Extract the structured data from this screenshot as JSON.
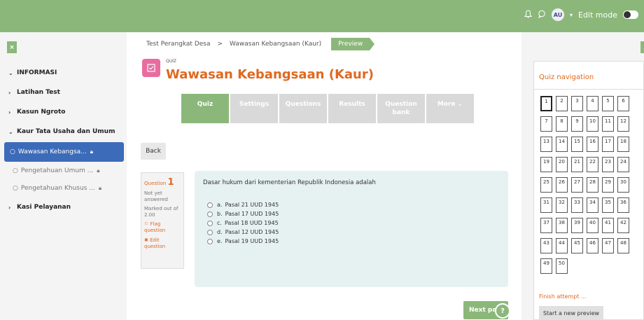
{
  "topbar": {
    "avatar_initials": "AU",
    "edit_mode_label": "Edit mode"
  },
  "drawer": {
    "close_glyph": "×",
    "items": [
      {
        "label": "INFORMASI",
        "kind": "section-open"
      },
      {
        "label": "Latihan Test",
        "kind": "section-closed"
      },
      {
        "label": "Kasun Ngroto",
        "kind": "section-closed"
      },
      {
        "label": "Kaur Tata Usaha dan Umum",
        "kind": "section-open"
      },
      {
        "label": "Wawasan Kebangsa...",
        "kind": "activity-active"
      },
      {
        "label": "Pengetahuan Umum ...",
        "kind": "activity"
      },
      {
        "label": "Pengetahuan Khusus ...",
        "kind": "activity"
      },
      {
        "label": "Kasi Pelayanan",
        "kind": "section-closed"
      }
    ]
  },
  "breadcrumb": {
    "items": [
      "Test Perangkat Desa",
      "Wawasan Kebangsaan (Kaur)"
    ],
    "separator": ">",
    "preview_label": "Preview"
  },
  "header": {
    "module_tag": "QUIZ",
    "title": "Wawasan Kebangsaan (Kaur)"
  },
  "tabs": [
    {
      "label": "Quiz",
      "active": true
    },
    {
      "label": "Settings",
      "active": false
    },
    {
      "label": "Questions",
      "active": false
    },
    {
      "label": "Results",
      "active": false
    },
    {
      "label": "Question bank",
      "active": false
    },
    {
      "label": "More ⌄",
      "active": false
    }
  ],
  "back_label": "Back",
  "question_info": {
    "label": "Question",
    "number": "1",
    "state": "Not yet answered",
    "marks": "Marked out of 2.00",
    "flag_label": "Flag question",
    "edit_label": "Edit question"
  },
  "question": {
    "text": "Dasar hukum dari kementerian Republik Indonesia adalah",
    "answers": [
      {
        "letter": "a.",
        "text": "Pasal 21 UUD 1945"
      },
      {
        "letter": "b.",
        "text": "Pasal 17 UUD 1945"
      },
      {
        "letter": "c.",
        "text": "Pasal 18 UUD 1945"
      },
      {
        "letter": "d.",
        "text": "Pasal 12 UUD 1945"
      },
      {
        "letter": "e.",
        "text": "Pasal 19 UUD 1945"
      }
    ]
  },
  "next_label": "Next pa",
  "help_glyph": "?",
  "quiz_nav": {
    "title": "Quiz navigation",
    "current": 1,
    "numbers": [
      "1",
      "2",
      "3",
      "4",
      "5",
      "6",
      "7",
      "8",
      "9",
      "10",
      "11",
      "12",
      "13",
      "14",
      "15",
      "16",
      "17",
      "18",
      "19",
      "20",
      "21",
      "22",
      "23",
      "24",
      "25",
      "26",
      "27",
      "28",
      "29",
      "30",
      "31",
      "32",
      "33",
      "34",
      "35",
      "36",
      "37",
      "38",
      "39",
      "40",
      "41",
      "42",
      "43",
      "44",
      "45",
      "46",
      "47",
      "48",
      "49",
      "50"
    ],
    "finish_label": "Finish attempt ...",
    "new_preview_label": "Start a new preview"
  },
  "colors": {
    "brand_green": "#8bb87a",
    "accent_orange": "#e0681f",
    "active_blue": "#3c6bb9"
  }
}
